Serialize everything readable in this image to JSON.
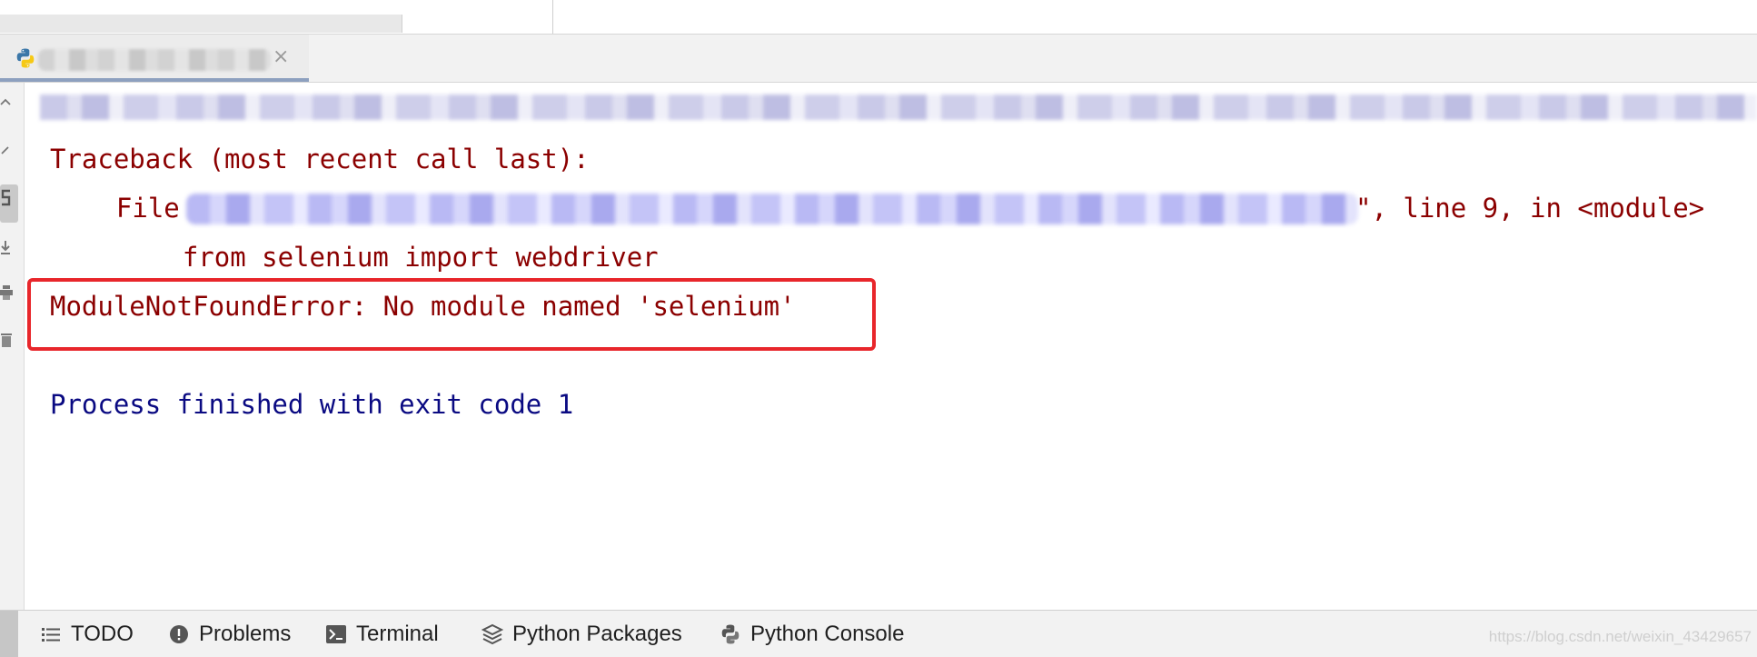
{
  "console": {
    "traceback_header": "Traceback (most recent call last):",
    "file_prefix": "  File \"",
    "file_suffix": "\", line 9, in <module>",
    "source_line": "    from selenium import webdriver",
    "error_line": "ModuleNotFoundError: No module named 'selenium'",
    "process_line": "Process finished with exit code 1"
  },
  "run_tab": {
    "close_glyph": "×",
    "icon": "python-icon"
  },
  "gutter": {
    "icons": [
      "up-arrow-icon",
      "soft-wrap-icon",
      "rerun-icon",
      "scroll-to-end-icon",
      "print-icon",
      "trash-icon"
    ]
  },
  "bottom_bar": {
    "todo": "TODO",
    "problems": "Problems",
    "terminal": "Terminal",
    "python_packages": "Python Packages",
    "python_console": "Python Console"
  },
  "watermark": "https://blog.csdn.net/weixin_43429657",
  "colors": {
    "error_text": "#8b0000",
    "process_text": "#0a0a82",
    "highlight_box": "#e8262b"
  }
}
